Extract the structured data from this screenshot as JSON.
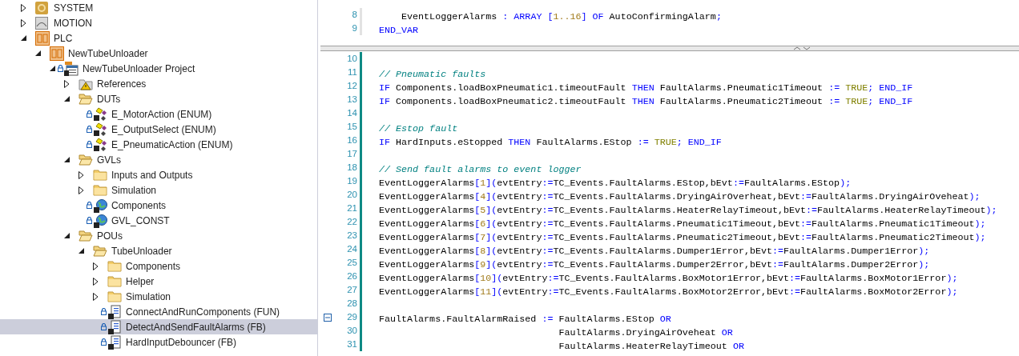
{
  "project_tree": [
    {
      "label": "SYSTEM",
      "kind": "system",
      "expanded": false,
      "locked": false,
      "selected": false
    },
    {
      "label": "MOTION",
      "kind": "motion",
      "expanded": false,
      "locked": false,
      "selected": false
    },
    {
      "label": "PLC",
      "kind": "plc",
      "expanded": true,
      "locked": false,
      "selected": false,
      "children": [
        {
          "label": "NewTubeUnloader",
          "kind": "plc",
          "expanded": true,
          "locked": false,
          "selected": false,
          "children": [
            {
              "label": "NewTubeUnloader Project",
              "kind": "project",
              "expanded": true,
              "locked": true,
              "selected": false,
              "children": [
                {
                  "label": "References",
                  "kind": "references",
                  "expanded": false,
                  "locked": false,
                  "selected": false
                },
                {
                  "label": "DUTs",
                  "kind": "openfolder",
                  "expanded": true,
                  "locked": false,
                  "selected": false,
                  "children": [
                    {
                      "label": "E_MotorAction (ENUM)",
                      "kind": "dut",
                      "locked": true,
                      "selected": false
                    },
                    {
                      "label": "E_OutputSelect (ENUM)",
                      "kind": "dut",
                      "locked": true,
                      "selected": false
                    },
                    {
                      "label": "E_PneumaticAction (ENUM)",
                      "kind": "dut",
                      "locked": true,
                      "selected": false
                    }
                  ]
                },
                {
                  "label": "GVLs",
                  "kind": "openfolder",
                  "expanded": true,
                  "locked": false,
                  "selected": false,
                  "children": [
                    {
                      "label": "Inputs and Outputs",
                      "kind": "folder",
                      "expanded": false,
                      "locked": false,
                      "selected": false
                    },
                    {
                      "label": "Simulation",
                      "kind": "folder",
                      "expanded": false,
                      "locked": false,
                      "selected": false
                    },
                    {
                      "label": "Components",
                      "kind": "gvl",
                      "locked": true,
                      "selected": false
                    },
                    {
                      "label": "GVL_CONST",
                      "kind": "gvl",
                      "locked": true,
                      "selected": false
                    }
                  ]
                },
                {
                  "label": "POUs",
                  "kind": "openfolder",
                  "expanded": true,
                  "locked": false,
                  "selected": false,
                  "children": [
                    {
                      "label": "TubeUnloader",
                      "kind": "openfolder",
                      "expanded": true,
                      "locked": false,
                      "selected": false,
                      "children": [
                        {
                          "label": "Components",
                          "kind": "folder",
                          "expanded": false,
                          "locked": false,
                          "selected": false
                        },
                        {
                          "label": "Helper",
                          "kind": "folder",
                          "expanded": false,
                          "locked": false,
                          "selected": false
                        },
                        {
                          "label": "Simulation",
                          "kind": "folder",
                          "expanded": false,
                          "locked": false,
                          "selected": false
                        },
                        {
                          "label": "ConnectAndRunComponents (FUN)",
                          "kind": "pou",
                          "locked": true,
                          "selected": false
                        },
                        {
                          "label": "DetectAndSendFaultAlarms (FB)",
                          "kind": "pou",
                          "locked": true,
                          "selected": true
                        },
                        {
                          "label": "HardInputDebouncer (FB)",
                          "kind": "pou",
                          "locked": true,
                          "selected": false
                        }
                      ]
                    }
                  ]
                }
              ]
            }
          ]
        }
      ]
    }
  ],
  "editor": {
    "declaration_lines": [
      {
        "number": "8",
        "segments": [
          {
            "kind": "plain",
            "text": "    EventLoggerAlarms "
          },
          {
            "kind": "operator",
            "text": ": "
          },
          {
            "kind": "keyword",
            "text": "ARRAY "
          },
          {
            "kind": "operator",
            "text": "["
          },
          {
            "kind": "number",
            "text": "1..16"
          },
          {
            "kind": "operator",
            "text": "] "
          },
          {
            "kind": "keyword",
            "text": "OF"
          },
          {
            "kind": "plain",
            "text": " AutoConfirmingAlarm"
          },
          {
            "kind": "operator",
            "text": ";"
          }
        ]
      },
      {
        "number": "9",
        "segments": [
          {
            "kind": "keyword",
            "text": "END_VAR"
          }
        ]
      }
    ],
    "body_lines": [
      {
        "number": "10"
      },
      {
        "number": "11",
        "segments": [
          {
            "kind": "comment",
            "text": "// Pneumatic faults"
          }
        ]
      },
      {
        "number": "12",
        "segments": [
          {
            "kind": "keyword",
            "text": "IF"
          },
          {
            "kind": "plain",
            "text": " Components.loadBoxPneumatic1.timeoutFault "
          },
          {
            "kind": "keyword",
            "text": "THEN"
          },
          {
            "kind": "plain",
            "text": " FaultAlarms.Pneumatic1Timeout "
          },
          {
            "kind": "operator",
            "text": ":= "
          },
          {
            "kind": "literal",
            "text": "TRUE"
          },
          {
            "kind": "operator",
            "text": "; "
          },
          {
            "kind": "keyword",
            "text": "END_IF"
          }
        ]
      },
      {
        "number": "13",
        "segments": [
          {
            "kind": "keyword",
            "text": "IF"
          },
          {
            "kind": "plain",
            "text": " Components.loadBoxPneumatic2.timeoutFault "
          },
          {
            "kind": "keyword",
            "text": "THEN"
          },
          {
            "kind": "plain",
            "text": " FaultAlarms.Pneumatic2Timeout "
          },
          {
            "kind": "operator",
            "text": ":= "
          },
          {
            "kind": "literal",
            "text": "TRUE"
          },
          {
            "kind": "operator",
            "text": "; "
          },
          {
            "kind": "keyword",
            "text": "END_IF"
          }
        ]
      },
      {
        "number": "14"
      },
      {
        "number": "15",
        "segments": [
          {
            "kind": "comment",
            "text": "// Estop fault"
          }
        ]
      },
      {
        "number": "16",
        "segments": [
          {
            "kind": "keyword",
            "text": "IF"
          },
          {
            "kind": "plain",
            "text": " HardInputs.eStopped "
          },
          {
            "kind": "keyword",
            "text": "THEN"
          },
          {
            "kind": "plain",
            "text": " FaultAlarms.EStop "
          },
          {
            "kind": "operator",
            "text": ":= "
          },
          {
            "kind": "literal",
            "text": "TRUE"
          },
          {
            "kind": "operator",
            "text": "; "
          },
          {
            "kind": "keyword",
            "text": "END_IF"
          }
        ]
      },
      {
        "number": "17"
      },
      {
        "number": "18",
        "segments": [
          {
            "kind": "comment",
            "text": "// Send fault alarms to event logger"
          }
        ]
      },
      {
        "number": "19",
        "segments": [
          {
            "kind": "plain",
            "text": "EventLoggerAlarms"
          },
          {
            "kind": "operator",
            "text": "["
          },
          {
            "kind": "number",
            "text": "1"
          },
          {
            "kind": "operator",
            "text": "]("
          },
          {
            "kind": "plain",
            "text": "evtEntry"
          },
          {
            "kind": "operator",
            "text": ":="
          },
          {
            "kind": "plain",
            "text": "TC_Events.FaultAlarms.EStop,bEvt"
          },
          {
            "kind": "operator",
            "text": ":="
          },
          {
            "kind": "plain",
            "text": "FaultAlarms.EStop"
          },
          {
            "kind": "operator",
            "text": ");"
          }
        ]
      },
      {
        "number": "20",
        "segments": [
          {
            "kind": "plain",
            "text": "EventLoggerAlarms"
          },
          {
            "kind": "operator",
            "text": "["
          },
          {
            "kind": "number",
            "text": "4"
          },
          {
            "kind": "operator",
            "text": "]("
          },
          {
            "kind": "plain",
            "text": "evtEntry"
          },
          {
            "kind": "operator",
            "text": ":="
          },
          {
            "kind": "plain",
            "text": "TC_Events.FaultAlarms.DryingAirOverheat,bEvt"
          },
          {
            "kind": "operator",
            "text": ":="
          },
          {
            "kind": "plain",
            "text": "FaultAlarms.DryingAirOveheat"
          },
          {
            "kind": "operator",
            "text": ");"
          }
        ]
      },
      {
        "number": "21",
        "segments": [
          {
            "kind": "plain",
            "text": "EventLoggerAlarms"
          },
          {
            "kind": "operator",
            "text": "["
          },
          {
            "kind": "number",
            "text": "5"
          },
          {
            "kind": "operator",
            "text": "]("
          },
          {
            "kind": "plain",
            "text": "evtEntry"
          },
          {
            "kind": "operator",
            "text": ":="
          },
          {
            "kind": "plain",
            "text": "TC_Events.FaultAlarms.HeaterRelayTimeout,bEvt"
          },
          {
            "kind": "operator",
            "text": ":="
          },
          {
            "kind": "plain",
            "text": "FaultAlarms.HeaterRelayTimeout"
          },
          {
            "kind": "operator",
            "text": ");"
          }
        ]
      },
      {
        "number": "22",
        "segments": [
          {
            "kind": "plain",
            "text": "EventLoggerAlarms"
          },
          {
            "kind": "operator",
            "text": "["
          },
          {
            "kind": "number",
            "text": "6"
          },
          {
            "kind": "operator",
            "text": "]("
          },
          {
            "kind": "plain",
            "text": "evtEntry"
          },
          {
            "kind": "operator",
            "text": ":="
          },
          {
            "kind": "plain",
            "text": "TC_Events.FaultAlarms.Pneumatic1Timeout,bEvt"
          },
          {
            "kind": "operator",
            "text": ":="
          },
          {
            "kind": "plain",
            "text": "FaultAlarms.Pneumatic1Timeout"
          },
          {
            "kind": "operator",
            "text": ");"
          }
        ]
      },
      {
        "number": "23",
        "segments": [
          {
            "kind": "plain",
            "text": "EventLoggerAlarms"
          },
          {
            "kind": "operator",
            "text": "["
          },
          {
            "kind": "number",
            "text": "7"
          },
          {
            "kind": "operator",
            "text": "]("
          },
          {
            "kind": "plain",
            "text": "evtEntry"
          },
          {
            "kind": "operator",
            "text": ":="
          },
          {
            "kind": "plain",
            "text": "TC_Events.FaultAlarms.Pneumatic2Timeout,bEvt"
          },
          {
            "kind": "operator",
            "text": ":="
          },
          {
            "kind": "plain",
            "text": "FaultAlarms.Pneumatic2Timeout"
          },
          {
            "kind": "operator",
            "text": ");"
          }
        ]
      },
      {
        "number": "24",
        "segments": [
          {
            "kind": "plain",
            "text": "EventLoggerAlarms"
          },
          {
            "kind": "operator",
            "text": "["
          },
          {
            "kind": "number",
            "text": "8"
          },
          {
            "kind": "operator",
            "text": "]("
          },
          {
            "kind": "plain",
            "text": "evtEntry"
          },
          {
            "kind": "operator",
            "text": ":="
          },
          {
            "kind": "plain",
            "text": "TC_Events.FaultAlarms.Dumper1Error,bEvt"
          },
          {
            "kind": "operator",
            "text": ":="
          },
          {
            "kind": "plain",
            "text": "FaultAlarms.Dumper1Error"
          },
          {
            "kind": "operator",
            "text": ");"
          }
        ]
      },
      {
        "number": "25",
        "segments": [
          {
            "kind": "plain",
            "text": "EventLoggerAlarms"
          },
          {
            "kind": "operator",
            "text": "["
          },
          {
            "kind": "number",
            "text": "9"
          },
          {
            "kind": "operator",
            "text": "]("
          },
          {
            "kind": "plain",
            "text": "evtEntry"
          },
          {
            "kind": "operator",
            "text": ":="
          },
          {
            "kind": "plain",
            "text": "TC_Events.FaultAlarms.Dumper2Error,bEvt"
          },
          {
            "kind": "operator",
            "text": ":="
          },
          {
            "kind": "plain",
            "text": "FaultAlarms.Dumper2Error"
          },
          {
            "kind": "operator",
            "text": ");"
          }
        ]
      },
      {
        "number": "26",
        "segments": [
          {
            "kind": "plain",
            "text": "EventLoggerAlarms"
          },
          {
            "kind": "operator",
            "text": "["
          },
          {
            "kind": "number",
            "text": "10"
          },
          {
            "kind": "operator",
            "text": "]("
          },
          {
            "kind": "plain",
            "text": "evtEntry"
          },
          {
            "kind": "operator",
            "text": ":="
          },
          {
            "kind": "plain",
            "text": "TC_Events.FaultAlarms.BoxMotor1Error,bEvt"
          },
          {
            "kind": "operator",
            "text": ":="
          },
          {
            "kind": "plain",
            "text": "FaultAlarms.BoxMotor1Error"
          },
          {
            "kind": "operator",
            "text": ");"
          }
        ]
      },
      {
        "number": "27",
        "segments": [
          {
            "kind": "plain",
            "text": "EventLoggerAlarms"
          },
          {
            "kind": "operator",
            "text": "["
          },
          {
            "kind": "number",
            "text": "11"
          },
          {
            "kind": "operator",
            "text": "]("
          },
          {
            "kind": "plain",
            "text": "evtEntry"
          },
          {
            "kind": "operator",
            "text": ":="
          },
          {
            "kind": "plain",
            "text": "TC_Events.FaultAlarms.BoxMotor2Error,bEvt"
          },
          {
            "kind": "operator",
            "text": ":="
          },
          {
            "kind": "plain",
            "text": "FaultAlarms.BoxMotor2Error"
          },
          {
            "kind": "operator",
            "text": ");"
          }
        ]
      },
      {
        "number": "28"
      },
      {
        "number": "29",
        "fold_expanded": true,
        "segments": [
          {
            "kind": "plain",
            "text": "FaultAlarms.FaultAlarmRaised "
          },
          {
            "kind": "operator",
            "text": ":="
          },
          {
            "kind": "plain",
            "text": " FaultAlarms.EStop "
          },
          {
            "kind": "keyword",
            "text": "OR"
          }
        ]
      },
      {
        "number": "30",
        "segments": [
          {
            "kind": "plain",
            "text": "                                FaultAlarms.DryingAirOveheat "
          },
          {
            "kind": "keyword",
            "text": "OR"
          }
        ]
      },
      {
        "number": "31",
        "segments": [
          {
            "kind": "plain",
            "text": "                                FaultAlarms.HeaterRelayTimeout "
          },
          {
            "kind": "keyword",
            "text": "OR"
          }
        ]
      }
    ]
  }
}
